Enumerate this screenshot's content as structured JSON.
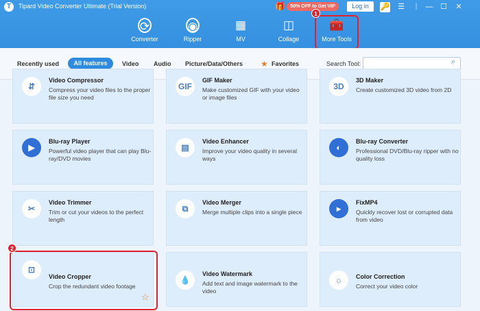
{
  "app": {
    "title": "Tipard Video Converter Ultimate (Trial Version)",
    "logo": "T",
    "promo": "50% OFF to Get VIP",
    "login": "Log in"
  },
  "window": {
    "key_icon": "🔑",
    "menu_icon": "☰",
    "separator": "|",
    "minimize": "—",
    "maximize": "☐",
    "close": "✕"
  },
  "nav": {
    "tabs": [
      {
        "label": "Converter",
        "icon": "⟳"
      },
      {
        "label": "Ripper",
        "icon": "◉"
      },
      {
        "label": "MV",
        "icon": "▦"
      },
      {
        "label": "Collage",
        "icon": "◫"
      },
      {
        "label": "More Tools",
        "icon": "🧰"
      }
    ],
    "active": "More Tools"
  },
  "annotations": {
    "step1": "1",
    "step2": "2",
    "color": "#e0212f"
  },
  "filters": {
    "tabs": [
      "Recently used",
      "All features",
      "Video",
      "Audio",
      "Picture/Data/Others",
      "Favorites"
    ],
    "active": "All features",
    "search_label": "Search Tool:",
    "search_placeholder": ""
  },
  "tools": [
    {
      "title": "Video Compressor",
      "desc": "Compress your video files to the proper file size you need",
      "icon": "⇵"
    },
    {
      "title": "GIF Maker",
      "desc": "Make customized GIF with your video or image files",
      "icon": "GIF"
    },
    {
      "title": "3D Maker",
      "desc": "Create customized 3D video from 2D",
      "icon": "3D"
    },
    {
      "title": "Blu-ray Player",
      "desc": "Powerful video player that can play Blu-ray/DVD movies",
      "icon": "▶"
    },
    {
      "title": "Video Enhancer",
      "desc": "Improve your video quality in several ways",
      "icon": "▤"
    },
    {
      "title": "Blu-ray Converter",
      "desc": "Professional DVD/Blu-ray ripper with no quality loss",
      "icon": "◐"
    },
    {
      "title": "Video Trimmer",
      "desc": "Trim or cut your videos to the perfect length",
      "icon": "✂"
    },
    {
      "title": "Video Merger",
      "desc": "Merge multiple clips into a single piece",
      "icon": "⧉"
    },
    {
      "title": "FixMP4",
      "desc": "Quickly recover lost or corrupted data from video",
      "icon": "▸"
    },
    {
      "title": "Video Cropper",
      "desc": "Crop the redundant video footage",
      "icon": "⊡"
    },
    {
      "title": "Video Watermark",
      "desc": "Add text and image watermark to the video",
      "icon": "💧"
    },
    {
      "title": "Color Correction",
      "desc": "Correct your video color",
      "icon": "☼"
    }
  ],
  "favorite_star": "☆",
  "colors": {
    "accent": "#2f8be0",
    "favorite": "#ef7d23"
  }
}
